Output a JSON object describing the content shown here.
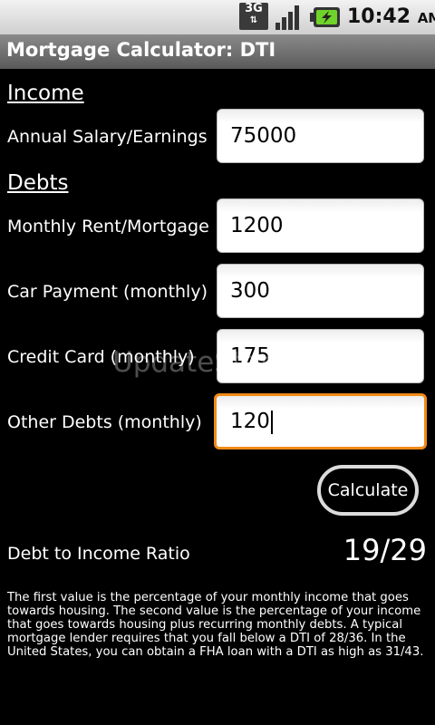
{
  "status_bar": {
    "network": "3G",
    "signal_icon": "signal-bars-icon",
    "battery_icon": "battery-charging-icon",
    "time": "10:42",
    "ampm": "AM"
  },
  "title": "Mortgage Calculator: DTI",
  "income": {
    "header": "Income",
    "salary_label": "Annual Salary/Earnings",
    "salary_value": "75000"
  },
  "debts": {
    "header": "Debts",
    "items": [
      {
        "label": "Monthly Rent/Mortgage",
        "value": "1200"
      },
      {
        "label": "Car Payment (monthly)",
        "value": "300"
      },
      {
        "label": "Credit Card (monthly)",
        "value": "175"
      },
      {
        "label": "Other Debts (monthly)",
        "value": "120"
      }
    ]
  },
  "calculate_label": "Calculate",
  "result": {
    "label": "Debt to Income Ratio",
    "value": "19/29"
  },
  "description": "The first value is the percentage of your monthly income that goes towards housing. The second value is the percentage of your income that goes towards housing plus recurring monthly debts. A typical mortgage lender requires that you fall below a DTI of 28/36. In the United States, you can obtain a FHA loan with a DTI as high as 31/43.",
  "watermark": "UpdateStar.com",
  "colors": {
    "focus_border": "#f28a16",
    "background": "#000000"
  }
}
